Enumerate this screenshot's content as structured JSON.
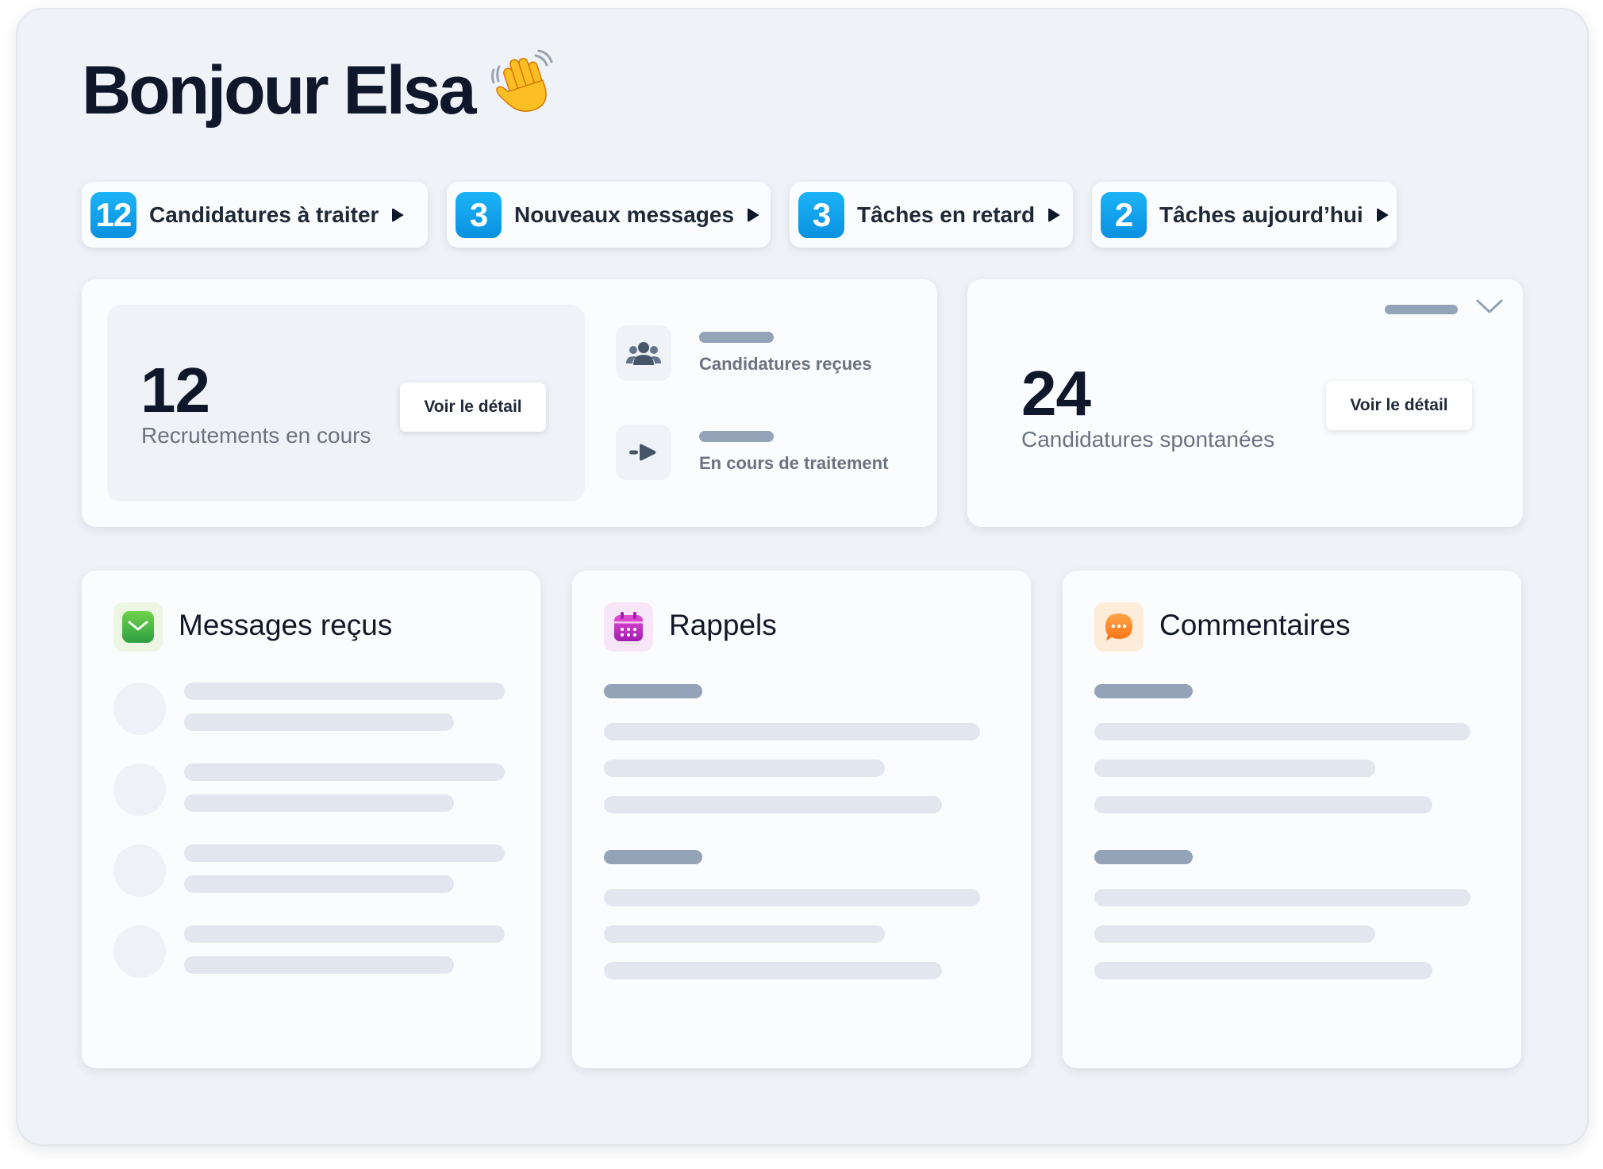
{
  "greeting": {
    "text": "Bonjour Elsa",
    "emoji": "waving-hand"
  },
  "shortcuts": [
    {
      "count": "12",
      "label": "Candidatures à traiter"
    },
    {
      "count": "3",
      "label": "Nouveaux messages"
    },
    {
      "count": "3",
      "label": "Tâches en retard"
    },
    {
      "count": "2",
      "label": "Tâches aujourd’hui"
    }
  ],
  "recruitment_card": {
    "value": "12",
    "label": "Recrutements en cours",
    "button": "Voir le détail",
    "items": [
      {
        "icon": "group-icon",
        "label": "Candidatures reçues"
      },
      {
        "icon": "arrow-right-icon",
        "label": "En cours de traitement"
      }
    ]
  },
  "spontaneous_card": {
    "value": "24",
    "label": "Candidatures spontanées",
    "button": "Voir le détail",
    "dropdown_icon": "chevron-down-icon"
  },
  "panels": {
    "messages": {
      "title": "Messages reçus",
      "icon": "envelope-icon",
      "icon_color": "#3cb43c"
    },
    "reminders": {
      "title": "Rappels",
      "icon": "calendar-icon",
      "icon_color": "#c026d3"
    },
    "comments": {
      "title": "Commentaires",
      "icon": "chat-icon",
      "icon_color": "#f97316"
    }
  },
  "colors": {
    "badge": "#0ea5e9",
    "background": "#eff2f7",
    "card": "#fbfcfd",
    "skeleton": "#e2e7ef",
    "skeleton_dark": "#94a3b8"
  }
}
